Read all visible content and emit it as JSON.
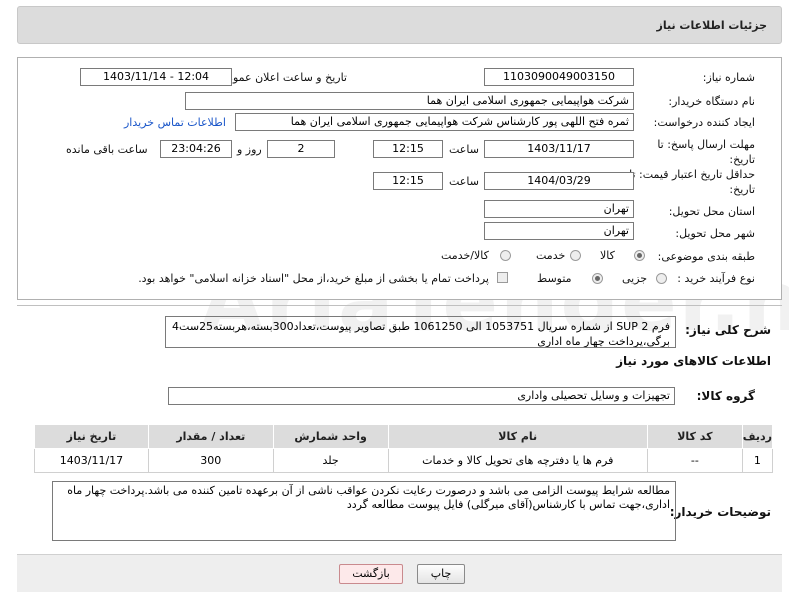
{
  "header": {
    "title": "جزئیات اطلاعات نیاز"
  },
  "fields": {
    "need_number_label": "شماره نیاز:",
    "need_number": "1103090049003150",
    "announce_label": "تاریخ و ساعت اعلان عمومی:",
    "announce_value": "1403/11/14 - 12:04",
    "buyer_org_label": "نام دستگاه خریدار:",
    "buyer_org": "شرکت هواپیمایی جمهوری اسلامی ایران هما",
    "requester_label": "ایجاد کننده درخواست:",
    "requester": "ثمره فتح اللهی پور کارشناس شرکت هواپیمایی جمهوری اسلامی ایران هما",
    "contact_link": "اطلاعات تماس خریدار",
    "deadline_label_1": "مهلت ارسال پاسخ: تا",
    "deadline_label_2": "تاریخ:",
    "deadline_date": "1403/11/17",
    "time_label": "ساعت",
    "deadline_time": "12:15",
    "days_value": "2",
    "days_and_label": "روز و",
    "remaining_time": "23:04:26",
    "remaining_label": "ساعت باقی مانده",
    "min_validity_label_1": "حداقل تاریخ اعتبار قیمت: تا",
    "min_validity_label_2": "تاریخ:",
    "validity_date": "1404/03/29",
    "validity_time_label": "ساعت",
    "validity_time": "12:15",
    "province_label": "استان محل تحویل:",
    "province": "تهران",
    "city_label": "شهر محل تحویل:",
    "city": "تهران",
    "category_label": "طبقه بندی موضوعی:",
    "category_options": [
      "کالا",
      "خدمت",
      "کالا/خدمت"
    ],
    "process_label": "نوع فرآیند خرید :",
    "process_options": [
      "جزیی",
      "متوسط"
    ],
    "payment_note": "پرداخت تمام یا بخشی از مبلغ خرید،از محل \"اسناد خزانه اسلامی\" خواهد بود."
  },
  "description": {
    "label": "شرح کلی نیاز:",
    "text": "فرم SUP 2 از شماره سریال 1053751 الی 1061250 طبق تصاویر پیوست،تعداد300بسته،هربسته25ست4 برگی،پرداخت چهار ماه اداری"
  },
  "goods_section_title": "اطلاعات کالاهای مورد نیاز",
  "goods_group_label": "گروه کالا:",
  "goods_group": "تجهیزات و وسایل تحصیلی واداری",
  "table": {
    "headers": [
      "ردیف",
      "کد کالا",
      "نام کالا",
      "واحد شمارش",
      "تعداد / مقدار",
      "تاریخ نیاز"
    ],
    "rows": [
      [
        "1",
        "--",
        "فرم ها یا دفترچه های تحویل کالا و خدمات",
        "جلد",
        "300",
        "1403/11/17"
      ]
    ]
  },
  "buyer_notes": {
    "label": "توضیحات خریدار:",
    "text": "مطالعه شرایط پیوست الزامی می باشد و درصورت رعایت نکردن عواقب ناشی از آن برعهده تامین کننده می باشد.پرداخت چهار ماه اداری،جهت تماس با کارشناس(آقای میرگلی) فایل پیوست مطالعه گردد"
  },
  "buttons": {
    "print": "چاپ",
    "back": "بازگشت"
  },
  "watermark": "AriaTender.neT"
}
